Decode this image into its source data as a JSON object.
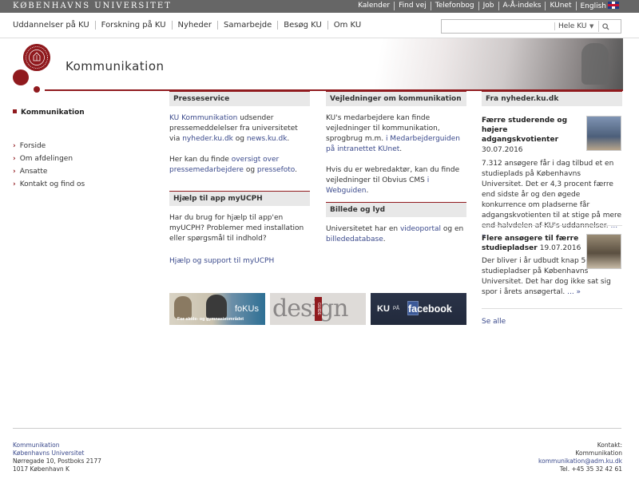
{
  "topbar": {
    "brand": "KØBENHAVNS UNIVERSITET",
    "links": [
      "Kalender",
      "Find vej",
      "Telefonbog",
      "Job",
      "A-Å-indeks",
      "KUnet",
      "English"
    ]
  },
  "nav": {
    "items": [
      "Uddannelser på KU",
      "Forskning på KU",
      "Nyheder",
      "Samarbejde",
      "Besøg KU",
      "Om KU"
    ],
    "search": {
      "placeholder": "",
      "scope": "Hele KU"
    }
  },
  "header": {
    "title": "Kommunikation"
  },
  "left_nav": {
    "active": "Kommunikation",
    "items": [
      "Forside",
      "Om afdelingen",
      "Ansatte",
      "Kontakt og find os"
    ]
  },
  "col1": {
    "presse": {
      "title": "Presseservice",
      "p1_link": "KU Kommunikation",
      "p1_text": " udsender pressemeddelelser fra universitetet via ",
      "p1_link2": "nyheder.ku.dk",
      "p1_og": " og ",
      "p1_link3": "news.ku.dk",
      "p1_end": ".",
      "p2_text": "Her kan du finde ",
      "p2_link": "oversigt over pressemedarbejdere",
      "p2_og": " og ",
      "p2_link2": "pressefoto",
      "p2_end": "."
    },
    "app": {
      "title": "Hjælp til app myUCPH",
      "text": "Har du brug for hjælp til app'en myUCPH? Problemer med installation eller spørgsmål til indhold?",
      "link": "Hjælp og support til myUCPH"
    }
  },
  "col2": {
    "vejl": {
      "title": "Vejledninger om kommunikation",
      "p1_text": "KU's medarbejdere kan finde vejledninger til kommunikation, sprogbrug m.m. ",
      "p1_link": "i Medarbejderguiden på intranettet KUnet",
      "p1_end": ".",
      "p2_text": "Hvis du er webredaktør, kan du finde vejledninger til Obvius CMS ",
      "p2_link": "i Webguiden",
      "p2_end": "."
    },
    "billede": {
      "title": "Billede og lyd",
      "text": "Universitetet har en ",
      "link1": "videoportal",
      "og": " og en ",
      "link2": "billededatabase",
      "end": "."
    }
  },
  "banners": {
    "fokus": {
      "title": "foKUs",
      "sub": "For skole- og gymnasieområdet"
    },
    "design": {
      "word": "design",
      "guide": "GUIDE"
    },
    "facebook": {
      "prefix": "KU",
      "pa": "PÅ",
      "word": "facebook"
    }
  },
  "news": {
    "title": "Fra nyheder.ku.dk",
    "items": [
      {
        "headline": "Færre studerende og højere adgangskvotienter",
        "date": "30.07.2016",
        "text": "7.312 ansøgere får i dag tilbud et en studieplads på Københavns Universitet. Det er 4,3 procent færre end sidste år og den øgede konkurrence om pladserne får adgangskvotienten til at stige på mere end halvdelen af KU's uddannelser.",
        "more": "... »"
      },
      {
        "headline": "Flere ansøgere til færre studiepladser",
        "date": "19.07.2016",
        "text": "Der bliver i år udbudt knap 500 færre studiepladser på Københavns Universitet. Det har dog ikke sat sig spor i årets ansøgertal.",
        "more": "... »"
      }
    ],
    "see_all": "Se alle"
  },
  "footer": {
    "left": [
      "Kommunikation",
      "Københavns Universitet",
      "Nørregade 10, Postboks 2177",
      "1017 København K"
    ],
    "right": [
      "Kontakt:",
      "Kommunikation",
      "kommunikation@adm.ku.dk",
      "Tel. +45 35 32 42 61"
    ]
  },
  "colors": {
    "ku_red": "#901a1e",
    "link": "#3b4a8c",
    "topbar": "#666666"
  }
}
